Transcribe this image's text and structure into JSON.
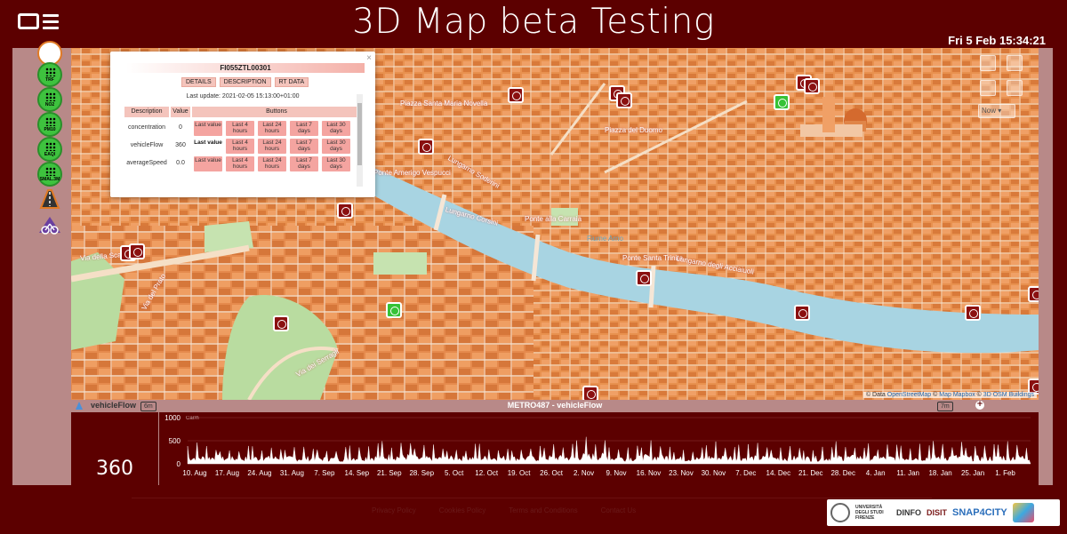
{
  "header": {
    "title": "3D Map beta Testing",
    "clock": "Fri 5 Feb 15:34:21"
  },
  "left_icons": [
    {
      "name": "traffic-sensor",
      "label": ""
    },
    {
      "name": "sensor-1",
      "label": "TRF"
    },
    {
      "name": "sensor-2",
      "label": "NO2"
    },
    {
      "name": "sensor-3",
      "label": "PM10"
    },
    {
      "name": "sensor-eaqi",
      "label": "EAQI"
    },
    {
      "name": "sensor-bike",
      "label": "SMAL.3M"
    },
    {
      "name": "road-icon",
      "label": ""
    },
    {
      "name": "bike-lanes",
      "label": ""
    }
  ],
  "map": {
    "labels": [
      "Piazza Santa Maria Novella",
      "Piazza del Duomo",
      "Ponte alla Carraia",
      "Ponte Santa Trinita",
      "Ponte Amerigo Vespucci",
      "Lungarno Soderini",
      "Lungarno degli Acciaiuoli",
      "Via dei Serragli",
      "Via del Prato",
      "Fiume Arno",
      "Via della Scala",
      "Lungarno Corsini"
    ],
    "time_select": "Now",
    "attribution_prefix": "© Data",
    "attribution_links": [
      "OpenStreetMap",
      "Map Mapbox",
      "3D OSM Buildings"
    ]
  },
  "popup": {
    "title": "FI055ZTL00301",
    "tabs": [
      "DETAILS",
      "DESCRIPTION",
      "RT DATA"
    ],
    "last_update": "Last update: 2021-02-05 15:13:00+01:00",
    "headers": {
      "description": "Description",
      "value": "Value",
      "buttons": "Buttons"
    },
    "rows": [
      {
        "description": "concentration",
        "value": "0",
        "buttons": [
          "Last value",
          "Last 4 hours",
          "Last 24 hours",
          "Last 7 days",
          "Last 30 days"
        ]
      },
      {
        "description": "vehicleFlow",
        "value": "360",
        "buttons": [
          "Last value",
          "Last 4 hours",
          "Last 24 hours",
          "Last 7 days",
          "Last 30 days"
        ]
      },
      {
        "description": "averageSpeed",
        "value": "0.0",
        "buttons": [
          "Last value",
          "Last 4 hours",
          "Last 24 hours",
          "Last 7 days",
          "Last 30 days"
        ]
      }
    ]
  },
  "widget": {
    "name": "vehicleFlow",
    "badge_left": "6m",
    "chart_title": "METRO487 - vehicleFlow",
    "badge_right": "7m",
    "current_value": "360",
    "unit": "Car/h"
  },
  "chart_data": {
    "type": "area",
    "title": "METRO487 - vehicleFlow",
    "ylabel": "Car/h",
    "ylim": [
      0,
      1000
    ],
    "y_ticks": [
      "1000",
      "500",
      "0"
    ],
    "x_ticks": [
      "10. Aug",
      "17. Aug",
      "24. Aug",
      "31. Aug",
      "7. Sep",
      "14. Sep",
      "21. Sep",
      "28. Sep",
      "5. Oct",
      "12. Oct",
      "19. Oct",
      "26. Oct",
      "2. Nov",
      "9. Nov",
      "16. Nov",
      "23. Nov",
      "30. Nov",
      "7. Dec",
      "14. Dec",
      "21. Dec",
      "28. Dec",
      "4. Jan",
      "11. Jan",
      "18. Jan",
      "25. Jan",
      "1. Feb"
    ],
    "series": [
      {
        "values": [
          320,
          270,
          300,
          280,
          260,
          330,
          370,
          280,
          300,
          310,
          290,
          320,
          400,
          300,
          350,
          270,
          340,
          310,
          300,
          290,
          330,
          300,
          330,
          350,
          300,
          350
        ]
      }
    ]
  },
  "footer": {
    "links": [
      "Privacy Policy",
      "Cookies Policy",
      "Terms and Conditions",
      "Contact Us"
    ],
    "logos": [
      "UNIVERSITÀ DEGLI STUDI FIRENZE",
      "DINFO",
      "DISIT",
      "SNAP4CITY"
    ]
  }
}
